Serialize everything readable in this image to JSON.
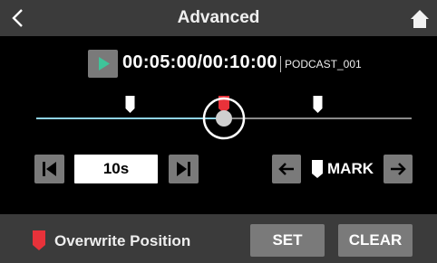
{
  "header": {
    "title": "Advanced",
    "back_icon": "chevron-left-icon",
    "home_icon": "home-icon"
  },
  "transport": {
    "play_icon": "play-icon",
    "time": "00:05:00/00:10:00",
    "filename": "PODCAST_001",
    "progress_fraction": 0.5
  },
  "timeline": {
    "marks": [
      {
        "name": "mark-1",
        "position_fraction": 0.25
      },
      {
        "name": "mark-2",
        "position_fraction": 0.75
      }
    ],
    "overwrite_marker_fraction": 0.5,
    "colors": {
      "played": "#8fd3e6",
      "remaining": "#8a8a8a",
      "overwrite": "#e8323a",
      "mark": "#ffffff"
    }
  },
  "controls": {
    "skip_back_icon": "skip-back-icon",
    "interval": "10s",
    "skip_forward_icon": "skip-forward-icon",
    "mark_prev_icon": "arrow-left-icon",
    "mark_label": "MARK",
    "mark_next_icon": "arrow-right-icon"
  },
  "footer": {
    "overwrite_label": "Overwrite Position",
    "set_label": "SET",
    "clear_label": "CLEAR"
  }
}
